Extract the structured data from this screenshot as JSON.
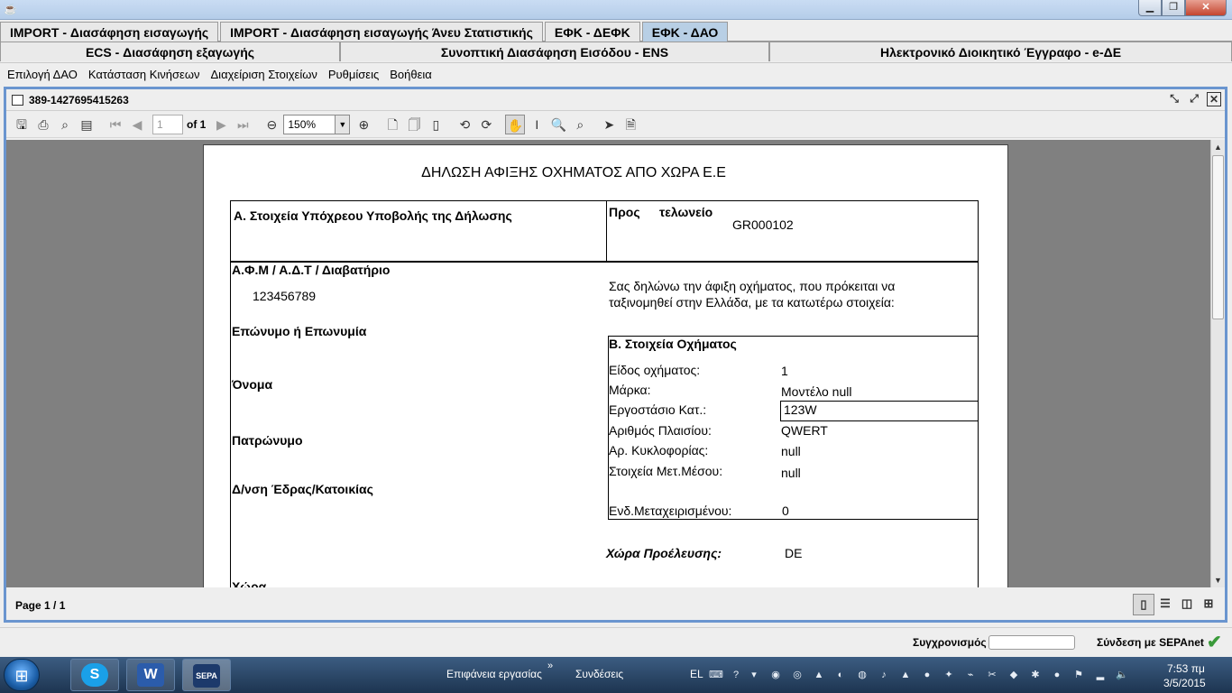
{
  "top_tabs": [
    {
      "label": "IMPORT - Διασάφηση εισαγωγής",
      "active": false
    },
    {
      "label": "IMPORT - Διασάφηση εισαγωγής Άνευ Στατιστικής",
      "active": false
    },
    {
      "label": "ΕΦΚ - ΔΕΦΚ",
      "active": false
    },
    {
      "label": "ΕΦΚ - ΔΑΟ",
      "active": true
    }
  ],
  "second_tabs": [
    {
      "label": "ECS - Διασάφηση εξαγωγής"
    },
    {
      "label": "Συνοπτική Διασάφηση Εισόδου - ENS"
    },
    {
      "label": "Ηλεκτρονικό Διοικητικό Έγγραφο - e-ΔΕ"
    }
  ],
  "menu": [
    "Επιλογή ΔΑΟ",
    "Κατάσταση Κινήσεων",
    "Διαχείριση Στοιχείων",
    "Ρυθμίσεις",
    "Βοήθεια"
  ],
  "frame": {
    "title": "389-1427695415263"
  },
  "toolbar": {
    "page_input": "1",
    "of_label": "of 1",
    "zoom": "150%",
    "icons": [
      "save-icon",
      "print-icon",
      "print-preview-icon",
      "export-icon",
      "first-page-icon",
      "prev-page-icon",
      "next-page-icon",
      "last-page-icon",
      "zoom-out-icon",
      "zoom-in-icon",
      "actual-size-icon",
      "fit-page-icon",
      "fit-width-icon",
      "rotate-left-icon",
      "rotate-right-icon",
      "pan-tool-icon",
      "text-select-icon",
      "zoom-tool-icon",
      "zoom-out-tool-icon",
      "pointer-icon",
      "find-icon"
    ]
  },
  "status": {
    "page": "Page 1 / 1"
  },
  "document": {
    "title": "ΔΗΛΩΣΗ ΑΦΙΞΗΣ ΟΧΗΜΑΤΟΣ ΑΠΟ ΧΩΡΑ Ε.Ε",
    "section_a": "Α. Στοιχεία Υπόχρεου Υποβολής της Δήλωσης",
    "customs_prefix": "Προς",
    "customs_label": "τελωνείο",
    "customs_code": "GR000102",
    "afm_label": "Α.Φ.Μ / Α.Δ.Τ / Διαβατήριο",
    "afm_value": "123456789",
    "declaration_line1": "Σας δηλώνω την άφιξη οχήματος, που πρόκειται να",
    "declaration_line2": "ταξινομηθεί στην Ελλάδα, με τα κατωτέρω στοιχεία:",
    "surname_label": "Επώνυμο ή Επωνυμία",
    "name_label": "Όνομα",
    "father_label": "Πατρώνυμο",
    "address_label": "Δ/νση Έδρας/Κατοικίας",
    "country_label": "Χώρα",
    "section_b": "Β. Στοιχεία Οχήματος",
    "vehicle_fields": [
      {
        "label": "Είδος οχήματος:",
        "value": "1"
      },
      {
        "label": "Μάρκα:",
        "value": "Μοντέλο null"
      },
      {
        "label": "Εργοστάσιο Κατ.:",
        "value": "123W"
      },
      {
        "label": "Αριθμός Πλαισίου:",
        "value": "QWERT"
      },
      {
        "label": "Αρ. Κυκλοφορίας:",
        "value": "null"
      },
      {
        "label": "Στοιχεία Μετ.Μέσου:",
        "value": "null"
      },
      {
        "label": "Ενδ.Μεταχειρισμένου:",
        "value": "0"
      }
    ],
    "origin_label": "Χώρα Προέλευσης:",
    "origin_value": "DE"
  },
  "app_status": {
    "sync_label": "Συγχρονισμός",
    "sepa_label": "Σύνδεση με SEPAnet"
  },
  "taskbar": {
    "apps": [
      "skype-icon",
      "word-icon",
      "sepa-icon"
    ],
    "sepa_text": "SEPA",
    "desktop_label": "Επιφάνεια εργασίας",
    "links_label": "Συνδέσεις",
    "lang": "EL",
    "time": "7:53 πμ",
    "date": "3/5/2015"
  }
}
